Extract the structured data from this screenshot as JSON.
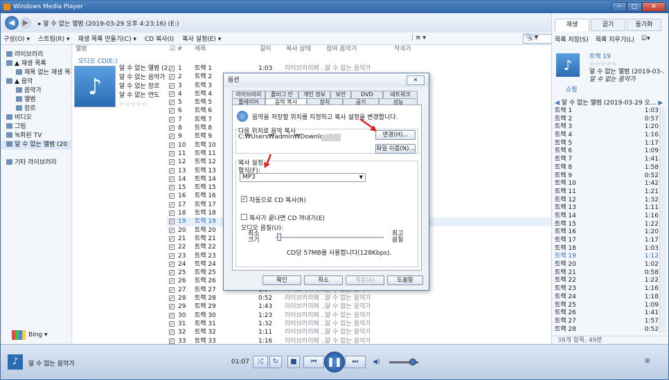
{
  "window": {
    "title": "Windows Media Player",
    "controls": [
      "─",
      "□",
      "✕"
    ]
  },
  "address": {
    "crumb": "▸  알 수 없는 앨범 (2019-03-29 오후 4:23:16) (E:)"
  },
  "toolbar": {
    "items": [
      "구성(O) ▾",
      "스트림(R) ▾",
      "재생 목록 만들기(C) ▾",
      "CD 복사(I)",
      "복사 설정(E) ▾"
    ],
    "view": "⋮≡ ▾",
    "search_placeholder": "검색",
    "search_icon": "🔍 ▾",
    "help": "?"
  },
  "nav": {
    "items": [
      {
        "label": "라이브러리",
        "level": 0
      },
      {
        "label": "▲ 재생 목록",
        "level": 0
      },
      {
        "label": "제목 없는 재생 목록",
        "level": 1
      },
      {
        "label": "▲ 음악",
        "level": 0
      },
      {
        "label": "음악가",
        "level": 1
      },
      {
        "label": "앨범",
        "level": 1
      },
      {
        "label": "장르",
        "level": 1
      },
      {
        "label": "비디오",
        "level": 0
      },
      {
        "label": "그림",
        "level": 0
      },
      {
        "label": "녹화된 TV",
        "level": 0
      },
      {
        "label": "알 수 없는 앨범 (20",
        "level": 0,
        "selected": true
      },
      {
        "label": "",
        "level": 0
      },
      {
        "label": "기타 라이브러리",
        "level": 0
      }
    ],
    "bing": "Bing ▾"
  },
  "columns": {
    "album": "앨범",
    "num": "☑ #",
    "title": "제목",
    "length": "길이",
    "status": "복사 상태",
    "contrib": "참여 음악가",
    "composer": "작곡가"
  },
  "album": {
    "source": "오디오 CD(E:)",
    "name": "알 수 없는 앨범 (2...",
    "artist": "알 수 없는 음악가",
    "genre": "알 수 없는 장르",
    "year": "알 수 없는 연도",
    "rating": "☆☆☆☆☆"
  },
  "tracks": [
    {
      "n": "1",
      "t": "트랙 1",
      "l": "1:03"
    },
    {
      "n": "2",
      "t": "트랙 2",
      "l": "0:57"
    },
    {
      "n": "3",
      "t": "트랙 3",
      "l": "1:20"
    },
    {
      "n": "4",
      "t": "트랙 4",
      "l": "1:16"
    },
    {
      "n": "5",
      "t": "트랙 5",
      "l": "1:17"
    },
    {
      "n": "6",
      "t": "트랙 6",
      "l": "1:09"
    },
    {
      "n": "7",
      "t": "트랙 7",
      "l": "1:41"
    },
    {
      "n": "8",
      "t": "트랙 8",
      "l": "1:58"
    },
    {
      "n": "9",
      "t": "트랙 9",
      "l": "0:52"
    },
    {
      "n": "10",
      "t": "트랙 10",
      "l": "1:42"
    },
    {
      "n": "11",
      "t": "트랙 11",
      "l": "1:21"
    },
    {
      "n": "12",
      "t": "트랙 12",
      "l": "1:32"
    },
    {
      "n": "13",
      "t": "트랙 13",
      "l": "1:11"
    },
    {
      "n": "14",
      "t": "트랙 14",
      "l": "1:16"
    },
    {
      "n": "15",
      "t": "트랙 15",
      "l": "1:22"
    },
    {
      "n": "16",
      "t": "트랙 16",
      "l": "1:20"
    },
    {
      "n": "17",
      "t": "트랙 17",
      "l": "1:17"
    },
    {
      "n": "18",
      "t": "트랙 18",
      "l": "1:03"
    },
    {
      "n": "19",
      "t": "트랙 19",
      "l": "1:12",
      "playing": true
    },
    {
      "n": "20",
      "t": "트랙 20",
      "l": "1:02"
    },
    {
      "n": "21",
      "t": "트랙 21",
      "l": "0:58"
    },
    {
      "n": "22",
      "t": "트랙 22",
      "l": "1:22"
    },
    {
      "n": "23",
      "t": "트랙 23",
      "l": "1:16"
    },
    {
      "n": "24",
      "t": "트랙 24",
      "l": "1:18"
    },
    {
      "n": "25",
      "t": "트랙 25",
      "l": "1:09"
    },
    {
      "n": "26",
      "t": "트랙 26",
      "l": "1:41"
    },
    {
      "n": "27",
      "t": "트랙 27",
      "l": "1:57"
    },
    {
      "n": "28",
      "t": "트랙 28",
      "l": "0:52"
    },
    {
      "n": "29",
      "t": "트랙 29",
      "l": "1:43"
    },
    {
      "n": "30",
      "t": "트랙 30",
      "l": "1:23"
    },
    {
      "n": "31",
      "t": "트랙 31",
      "l": "1:32"
    },
    {
      "n": "32",
      "t": "트랙 32",
      "l": "1:11"
    },
    {
      "n": "33",
      "t": "트랙 33",
      "l": "1:16"
    }
  ],
  "track_status": "라이브러리에 ...",
  "track_artist": "알 수 없는 음악가",
  "right": {
    "tabs": [
      "재생",
      "굽기",
      "동기화"
    ],
    "save_list": "목록 저장(S)",
    "clear_list": "목록 지우기(L)",
    "opts": "☑▾",
    "now_title": "트랙 19",
    "now_rating": "☆☆☆☆☆",
    "now_album": "알 수 없는 앨범 (2019-03-...",
    "now_artist": "알 수 없는 음악가",
    "shop": "쇼핑",
    "list_header": "알 수 없는 앨범 (2019-03-29 오...",
    "footer": "38개 항목, 49분"
  },
  "player": {
    "now_playing": "알 수 없는 음악가",
    "time": "01:07",
    "shuffle": "⤮",
    "repeat": "↻",
    "stop": "■",
    "prev": "⏮",
    "play": "❚❚",
    "next": "⏭",
    "volume_icon": "◀)",
    "volume_level": 0.8,
    "switch": "⊞"
  },
  "dialog": {
    "title": "옵션",
    "close": "✕",
    "tabs_row1": [
      "라이브러리",
      "플러그 인",
      "개인 정보",
      "보안",
      "DVD",
      "네트워크"
    ],
    "tabs_row2": [
      "플레이어",
      "음악 복사",
      "장치",
      "굽기",
      "성능"
    ],
    "active_tab": "음악 복사",
    "intro": "음악을 저장할 위치를 지정하고 복사 설정을 변경합니다.",
    "location_label": "다음 위치로 음악 복사",
    "path": "C:₩Users₩admin₩Downloads₩",
    "change_btn": "변경(H)...",
    "filename_btn": "파일 이름(N)...",
    "settings_label": "복사 설정",
    "format_label": "형식(F):",
    "format_value": "MP3",
    "auto_copy": "자동으로 CD 복사(R)",
    "auto_copy_checked": true,
    "eject": "복사가 끝나면 CD 꺼내기(E)",
    "eject_checked": false,
    "quality_label": "오디오 음질(U):",
    "min_label": "최소\n크기",
    "max_label": "최고\n음질",
    "usage": "CD당 57MB를 사용합니다(128Kbps).",
    "ok": "확인",
    "cancel": "취소",
    "apply": "적용(A)",
    "help": "도움말"
  }
}
